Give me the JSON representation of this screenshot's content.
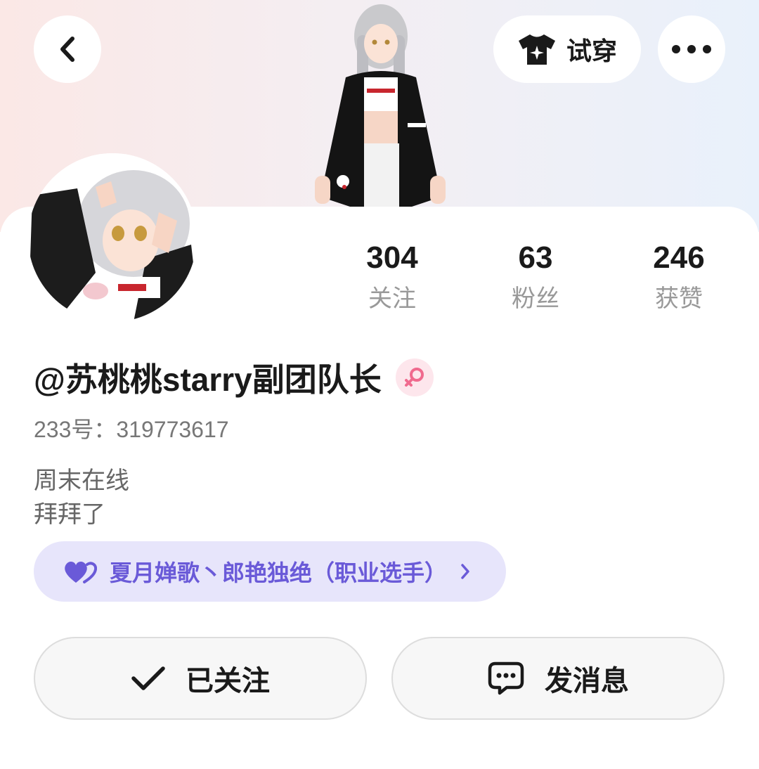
{
  "header": {
    "back_icon": "chevron-left-icon",
    "tryon_label": "试穿",
    "tryon_icon": "tshirt-sparkle-icon",
    "more_icon": "more-dots-icon"
  },
  "stats": [
    {
      "value": "304",
      "label": "关注"
    },
    {
      "value": "63",
      "label": "粉丝"
    },
    {
      "value": "246",
      "label": "获赞"
    }
  ],
  "profile": {
    "username": "@苏桃桃starry副团队长",
    "gender_icon": "female-icon",
    "uid": "233号：319773617",
    "bio_line1": "周末在线",
    "bio_line2": "拜拜了"
  },
  "team": {
    "icon": "double-heart-icon",
    "text": "夏月婵歌丶郎艳独绝（职业选手）",
    "arrow_icon": "chevron-right-icon"
  },
  "actions": {
    "follow_label": "已关注",
    "follow_icon": "check-icon",
    "message_label": "发消息",
    "message_icon": "chat-bubble-icon"
  },
  "colors": {
    "accent_purple": "#6a5ad8",
    "team_bg": "#e7e5fb",
    "gender_pink": "#f06a8e"
  }
}
